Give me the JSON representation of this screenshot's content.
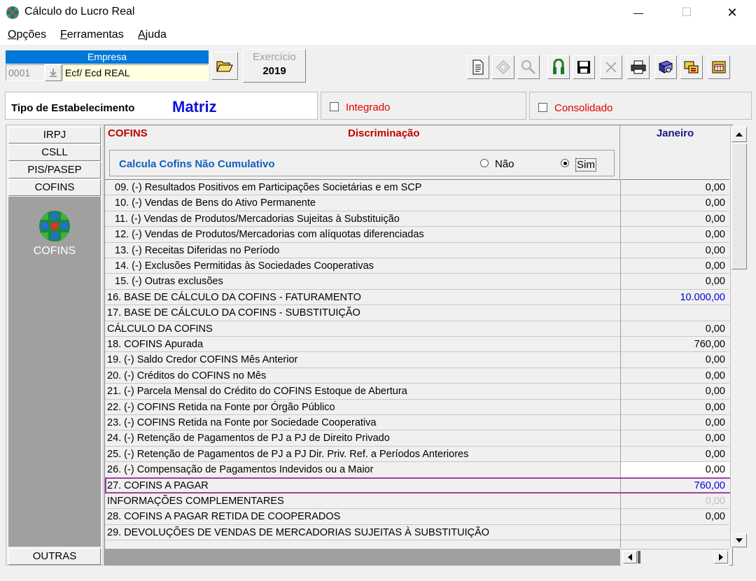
{
  "window": {
    "title": "Cálculo do Lucro Real",
    "minimize": "—",
    "maximize": "☐",
    "close": "✕"
  },
  "menu": {
    "opcoes": {
      "hotkey": "O",
      "rest": "pções"
    },
    "ferramentas": {
      "hotkey": "F",
      "rest": "erramentas"
    },
    "ajuda": {
      "hotkey": "A",
      "rest": "juda"
    }
  },
  "empresa": {
    "label": "Empresa",
    "code": "0001",
    "name": "Ecf/ Ecd REAL"
  },
  "exercicio": {
    "label": "Exercício",
    "year": "2019"
  },
  "estabelecimento": {
    "label": "Tipo de Estabelecimento",
    "value": "Matriz",
    "integrado": "Integrado",
    "consolidado": "Consolidado"
  },
  "tabs": {
    "irpj": "IRPJ",
    "csll": "CSLL",
    "pis": "PIS/PASEP",
    "cofins": "COFINS",
    "panel_label": "COFINS",
    "outras": "OUTRAS"
  },
  "grid": {
    "header_left": "COFINS",
    "header_center": "Discriminação",
    "header_month": "Janeiro",
    "calc_label": "Calcula Cofins Não Cumulativo",
    "option_nao": "Não",
    "option_sim": "Sim",
    "selected_option": "Sim",
    "rows": [
      {
        "label": "09. (-) Resultados Positivos em Participações Societárias e em SCP",
        "value": "0,00",
        "indent": true
      },
      {
        "label": "10. (-) Vendas de Bens do Ativo Permanente",
        "value": "0,00",
        "indent": true
      },
      {
        "label": "11. (-) Vendas de Produtos/Mercadorias Sujeitas à Substituição",
        "value": "0,00",
        "indent": true
      },
      {
        "label": "12. (-) Vendas de Produtos/Mercadorias com alíquotas diferenciadas",
        "value": "0,00",
        "indent": true
      },
      {
        "label": "13. (-) Receitas Diferidas no Período",
        "value": "0,00",
        "indent": true
      },
      {
        "label": "14. (-) Exclusões Permitidas às Sociedades Cooperativas",
        "value": "0,00",
        "indent": true
      },
      {
        "label": "15. (-) Outras exclusões",
        "value": "0,00",
        "indent": true
      },
      {
        "label": "16. BASE DE CÁLCULO DA COFINS - FATURAMENTO",
        "value": "10.000,00",
        "indent": false,
        "value_color": "blue"
      },
      {
        "label": "17. BASE DE CÁLCULO DA COFINS - SUBSTITUIÇÃO",
        "value": "",
        "indent": false
      },
      {
        "label": "CÁLCULO DA COFINS",
        "value": "0,00",
        "indent": false
      },
      {
        "label": "18. COFINS Apurada",
        "value": "760,00",
        "indent": false
      },
      {
        "label": "19. (-) Saldo Credor COFINS Mês Anterior",
        "value": "0,00",
        "indent": false
      },
      {
        "label": "20. (-) Créditos do COFINS no Mês",
        "value": "0,00",
        "indent": false
      },
      {
        "label": "21. (-) Parcela Mensal do Crédito do COFINS Estoque de Abertura",
        "value": "0,00",
        "indent": false
      },
      {
        "label": "22. (-) COFINS Retida na Fonte por Órgão Público",
        "value": "0,00",
        "indent": false
      },
      {
        "label": "23. (-) COFINS Retida na Fonte por Sociedade Cooperativa",
        "value": "0,00",
        "indent": false
      },
      {
        "label": "24. (-) Retenção de Pagamentos de PJ a PJ de Direito Privado",
        "value": "0,00",
        "indent": false
      },
      {
        "label": "25. (-) Retenção de Pagamentos de PJ a PJ Dir. Priv. Ref. a Períodos Anteriores",
        "value": "0,00",
        "indent": false
      },
      {
        "label": "26. (-) Compensação de Pagamentos Indevidos ou a Maior",
        "value": "0,00",
        "indent": false,
        "white": true
      },
      {
        "label": "27. COFINS A PAGAR",
        "value": "760,00",
        "indent": false,
        "value_color": "blue",
        "highlight": true
      },
      {
        "label": "INFORMAÇÕES COMPLEMENTARES",
        "value": "0,00",
        "indent": false,
        "value_color": "grey"
      },
      {
        "label": "28. COFINS A PAGAR RETIDA DE COOPERADOS",
        "value": "0,00",
        "indent": false
      },
      {
        "label": "29. DEVOLUÇÕES DE VENDAS DE MERCADORIAS SUJEITAS À SUBSTITUIÇÃO",
        "value": "",
        "indent": false
      }
    ]
  },
  "colors": {
    "highlight_border": "#a040a0",
    "empresa_header": "#0078d7",
    "empresa_input": "#ffffe1",
    "red_header": "#c00000",
    "matriz_blue": "#1010e0",
    "calc_blue": "#1060c0",
    "panel_grey": "#a0a0a0"
  }
}
